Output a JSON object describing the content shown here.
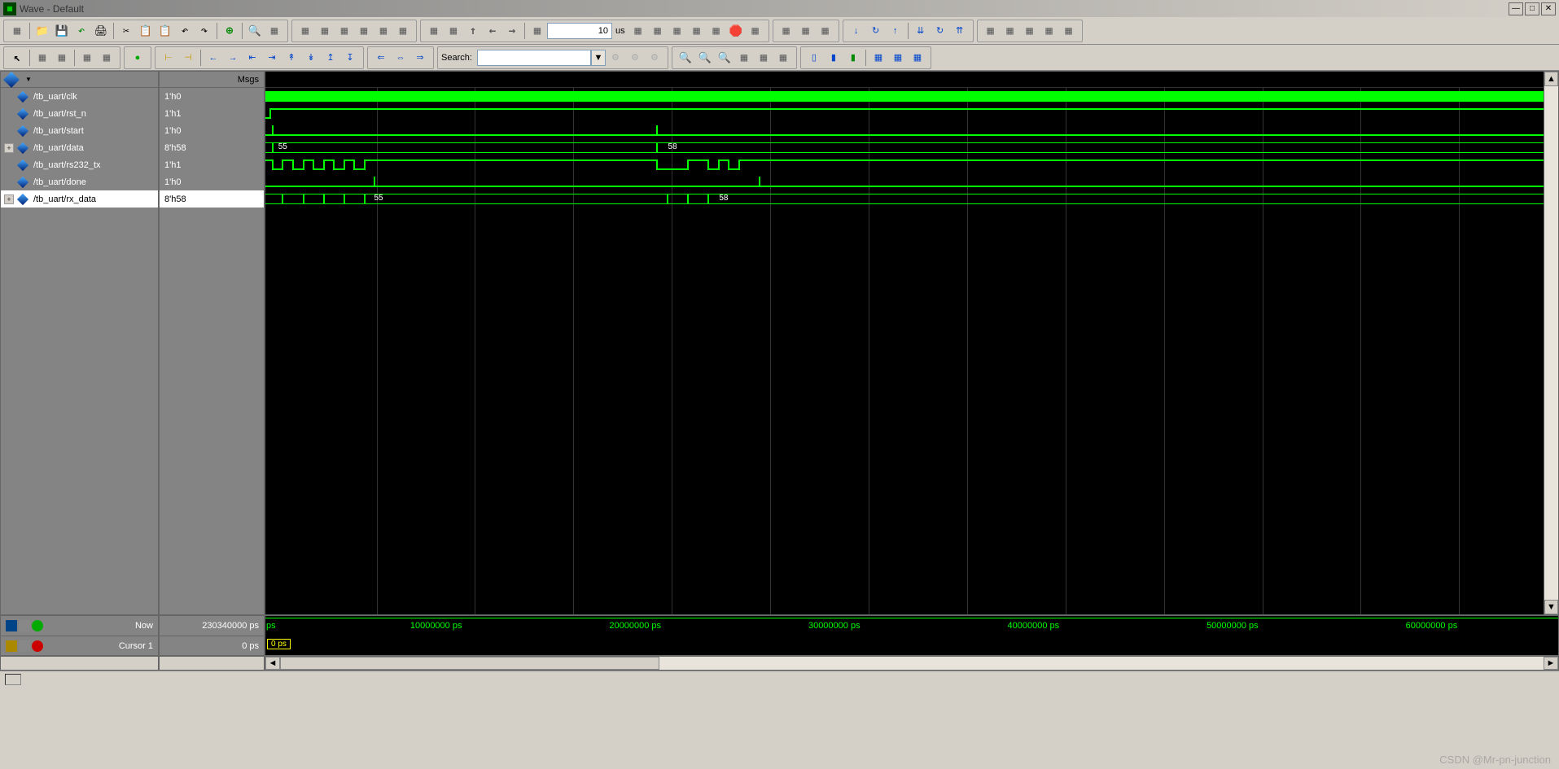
{
  "window": {
    "title": "Wave - Default"
  },
  "toolbar": {
    "time_value": "10",
    "time_unit": "us",
    "search_label": "Search:"
  },
  "panels": {
    "msgs_header": "Msgs"
  },
  "signals": [
    {
      "name": "/tb_uart/clk",
      "value": "1'h0",
      "expandable": false
    },
    {
      "name": "/tb_uart/rst_n",
      "value": "1'h1",
      "expandable": false
    },
    {
      "name": "/tb_uart/start",
      "value": "1'h0",
      "expandable": false
    },
    {
      "name": "/tb_uart/data",
      "value": "8'h58",
      "expandable": true
    },
    {
      "name": "/tb_uart/rs232_tx",
      "value": "1'h1",
      "expandable": false
    },
    {
      "name": "/tb_uart/done",
      "value": "1'h0",
      "expandable": false
    },
    {
      "name": "/tb_uart/rx_data",
      "value": "8'h58",
      "expandable": true,
      "selected": true
    }
  ],
  "wave_values": {
    "data_val1": "55",
    "data_val2": "58",
    "rx_val1": "55",
    "rx_val2": "58"
  },
  "time_ruler": [
    {
      "pos": 11.2,
      "label": "10000000 ps"
    },
    {
      "pos": 26.6,
      "label": "20000000 ps"
    },
    {
      "pos": 42.0,
      "label": "30000000 ps"
    },
    {
      "pos": 57.4,
      "label": "40000000 ps"
    },
    {
      "pos": 72.8,
      "label": "50000000 ps"
    },
    {
      "pos": 88.2,
      "label": "60000000 ps"
    }
  ],
  "bottom": {
    "now_label": "Now",
    "now_value": "230340000 ps",
    "cursor_label": "Cursor 1",
    "cursor_value": "0 ps",
    "cursor_marker": "0 ps",
    "ps_label": "ps"
  },
  "watermark": "CSDN @Mr-pn-junction"
}
